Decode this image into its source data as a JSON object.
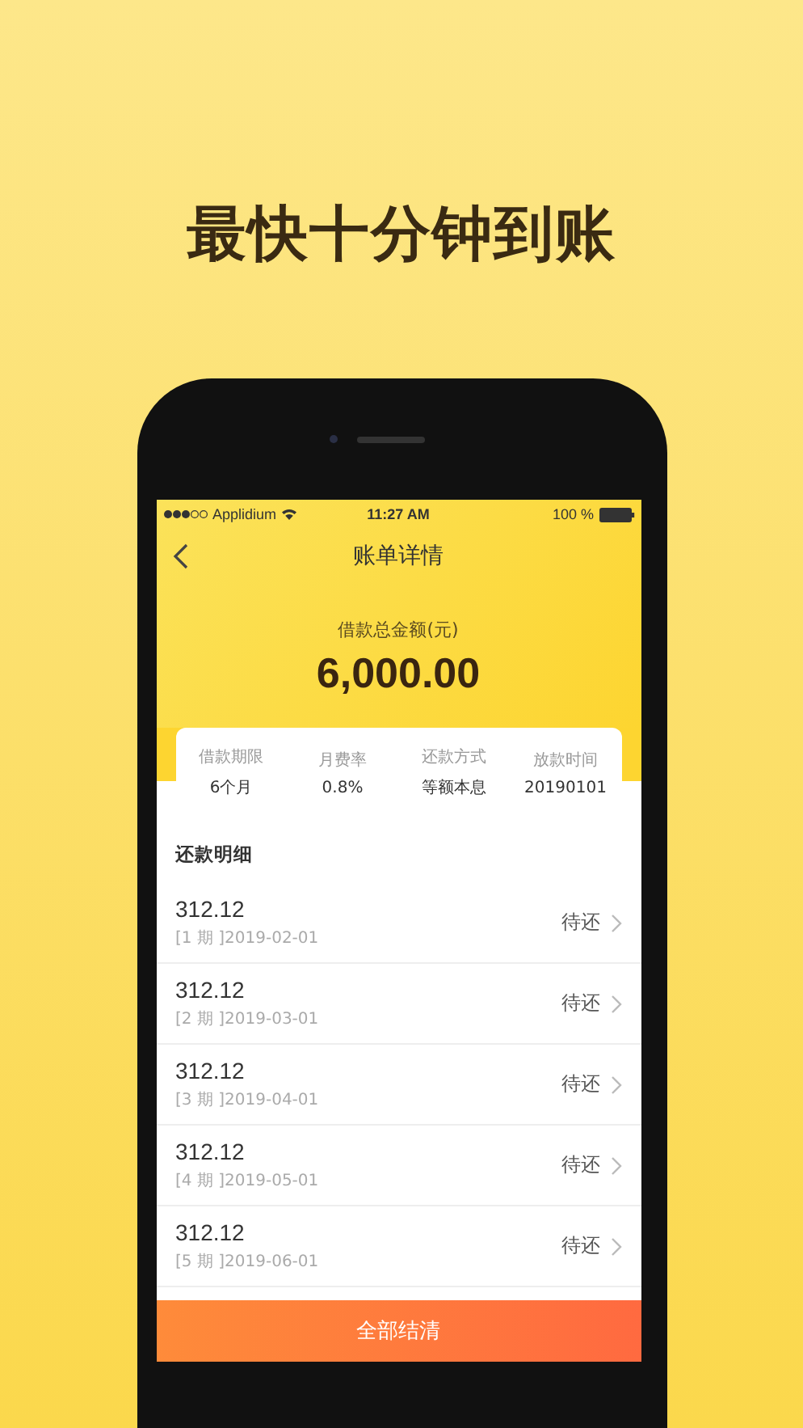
{
  "headline": "最快十分钟到账",
  "status_bar": {
    "carrier": "Applidium",
    "time": "11:27 AM",
    "battery": "100 %"
  },
  "nav": {
    "title": "账单详情"
  },
  "summary": {
    "label": "借款总金额(元)",
    "amount": "6,000.00"
  },
  "terms": [
    {
      "label": "借款期限",
      "value": "6个月"
    },
    {
      "label": "月费率",
      "value": "0.8%"
    },
    {
      "label": "还款方式",
      "value": "等额本息"
    },
    {
      "label": "放款时间",
      "value": "20190101"
    }
  ],
  "section_title": "还款明细",
  "installments": [
    {
      "amount": "312.12",
      "period": "[1 期 ]2019-02-01",
      "status": "待还"
    },
    {
      "amount": "312.12",
      "period": "[2 期 ]2019-03-01",
      "status": "待还"
    },
    {
      "amount": "312.12",
      "period": "[3 期 ]2019-04-01",
      "status": "待还"
    },
    {
      "amount": "312.12",
      "period": "[4 期 ]2019-05-01",
      "status": "待还"
    },
    {
      "amount": "312.12",
      "period": "[5 期 ]2019-06-01",
      "status": "待还"
    }
  ],
  "action_button": "全部结清"
}
